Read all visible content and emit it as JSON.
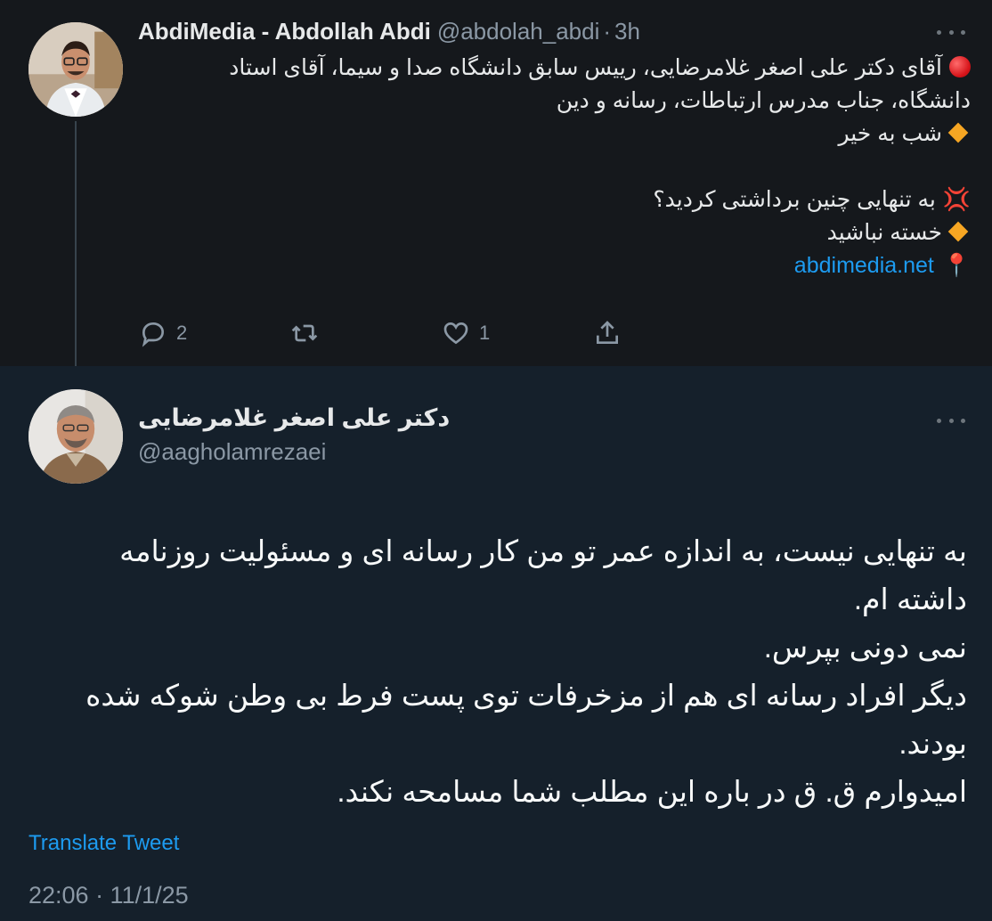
{
  "parent_tweet": {
    "author_name": "AbdiMedia - Abdollah Abdi",
    "handle": "@abdolah_abdi",
    "separator": "·",
    "time": "3h",
    "text_lines": [
      "آقای دکتر علی اصغر غلامرضایی، رییس سابق دانشگاه صدا و سیما، آقای استاد",
      "دانشگاه، جناب مدرس ارتباطات، رسانه و دین",
      "شب به خیر",
      "",
      "به تنهایی چنین برداشتی کردید؟",
      "خسته نباشید"
    ],
    "link_text": "abdimedia.net",
    "anger_symbol": "💢",
    "pin_symbol": "📍",
    "reply_count": "2",
    "retweet_count": "",
    "like_count": "1",
    "icons": [
      "reply-icon",
      "retweet-icon",
      "like-icon",
      "share-icon"
    ]
  },
  "main_tweet": {
    "author_name": "دکتر علی اصغر غلامرضایی",
    "handle": "@aagholamrezaei",
    "text_lines": [
      "به تنهایی نیست، به اندازه عمر تو من کار رسانه ای و مسئولیت روزنامه",
      "داشته ام.",
      "نمی دونی بپرس.",
      "دیگر افراد رسانه ای هم از مزخرفات توی پست فرط بی وطن شوکه شده",
      "بودند.",
      "امیدوارم ق. ق در باره این مطلب شما مسامحه نکند."
    ],
    "translate_label": "Translate Tweet",
    "timestamp": "22:06 · 11/1/25"
  },
  "colors": {
    "background": "#15202b",
    "parent_background": "#15181c",
    "accent": "#1d9bf0",
    "secondary_text": "#8b98a5"
  }
}
